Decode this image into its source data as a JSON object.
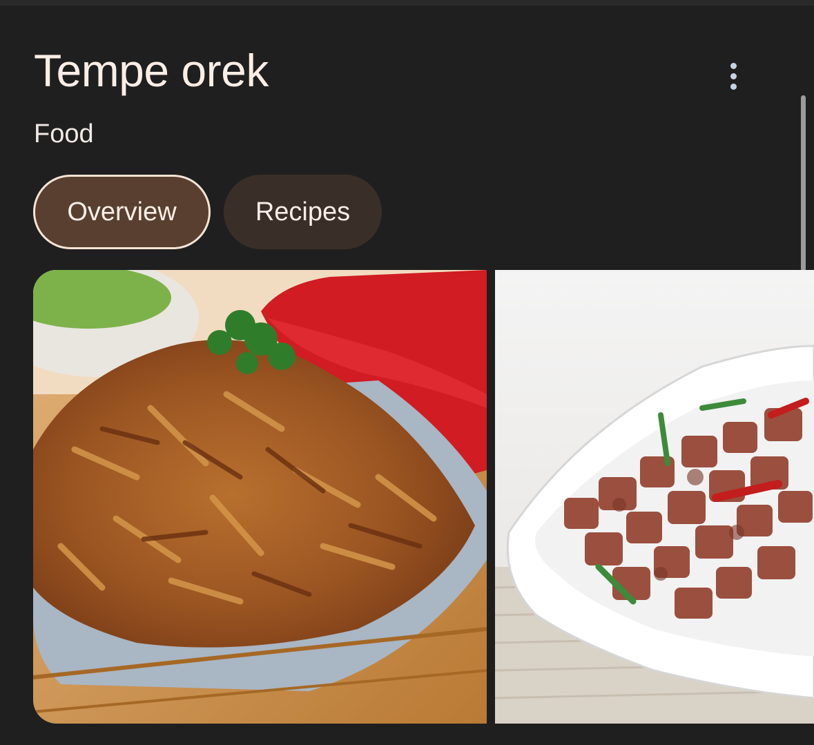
{
  "header": {
    "title": "Tempe orek",
    "subtitle": "Food",
    "more_icon": "more-vert-icon"
  },
  "tabs": [
    {
      "label": "Overview",
      "selected": true
    },
    {
      "label": "Recipes",
      "selected": false
    }
  ],
  "images": [
    {
      "description_icon": "photo"
    },
    {
      "description_icon": "photo"
    }
  ],
  "colors": {
    "background": "#1f1f1f",
    "chip_selected_bg": "#583f30",
    "chip_bg": "#3a2f28",
    "text": "#fbeee6"
  }
}
